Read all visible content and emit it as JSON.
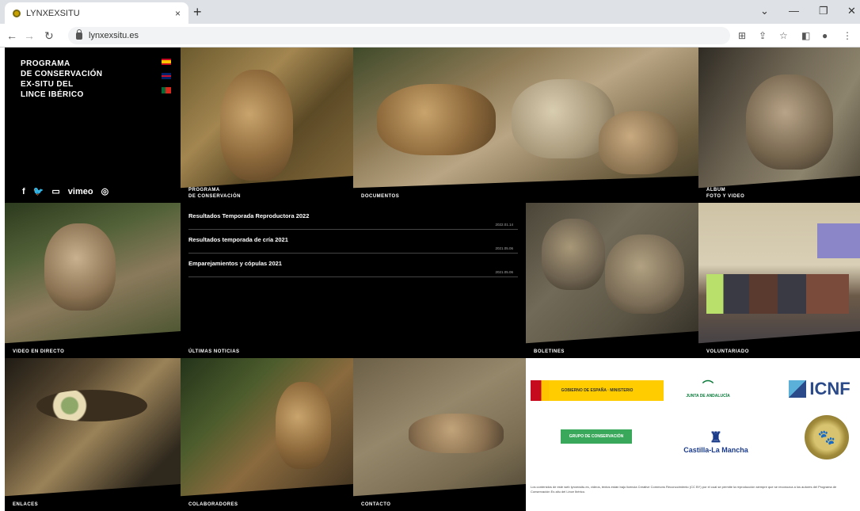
{
  "browser": {
    "tab_title": "LYNXEXSITU",
    "tab_close": "×",
    "new_tab": "+",
    "url": "lynxexsitu.es",
    "window_controls": [
      "⌄",
      "—",
      "❐",
      "✕"
    ]
  },
  "site": {
    "program_title": [
      "PROGRAMA",
      "DE CONSERVACIÓN",
      "EX-SITU DEL",
      "LINCE IBÉRICO"
    ],
    "flags": [
      {
        "icon": "flag-spain-icon",
        "colors": [
          "#c60b1e",
          "#ffc400",
          "#c60b1e"
        ]
      },
      {
        "icon": "flag-uk-icon",
        "colors": [
          "#012169",
          "#c8102e",
          "#012169"
        ]
      },
      {
        "icon": "flag-portugal-icon",
        "colors": [
          "#046a38",
          "#da291c",
          "#da291c"
        ]
      }
    ],
    "social": {
      "facebook": "f",
      "twitter": "🐦",
      "youtube": "▭",
      "vimeo": "vimeo",
      "instagram": "◎"
    },
    "tiles": {
      "programa": "PROGRAMA\nDE CONSERVACIÓN",
      "documentos": "DOCUMENTOS",
      "album": "ALBUM\nFOTO Y VIDEO",
      "video": "VIDEO EN DIRECTO",
      "noticias": "ÚLTIMAS NOTICIAS",
      "boletines": "BOLETINES",
      "voluntariado": "VOLUNTARIADO",
      "enlaces": "ENLACES",
      "colaboradores": "COLABORADORES",
      "contacto": "CONTACTO"
    },
    "news": [
      {
        "title": "Resultados Temporada Reproductora 2022",
        "date": "2022.01.14"
      },
      {
        "title": "Resultados temporada de cría 2021",
        "date": "2021.05.06"
      },
      {
        "title": "Emparejamientos y cópulas 2021",
        "date": "2021.05.06"
      }
    ],
    "logos": {
      "ministerio": "GOBIERNO DE ESPAÑA · MINISTERIO",
      "junta": "JUNTA DE ANDALUCÍA",
      "icnf": "ICNF",
      "life": "GRUPO DE CONSERVACIÓN",
      "castilla": "Castilla-La Mancha",
      "footer_text": "Los contenidos de este web lynxexsitu.es, vídeos, textos están bajo licencia Creative Commons Reconocimiento (CC BY) por el cual se permite la reproducción siempre que se reconozca a los autores del Programa de Conservación Ex-situ del Lince Ibérico."
    }
  }
}
